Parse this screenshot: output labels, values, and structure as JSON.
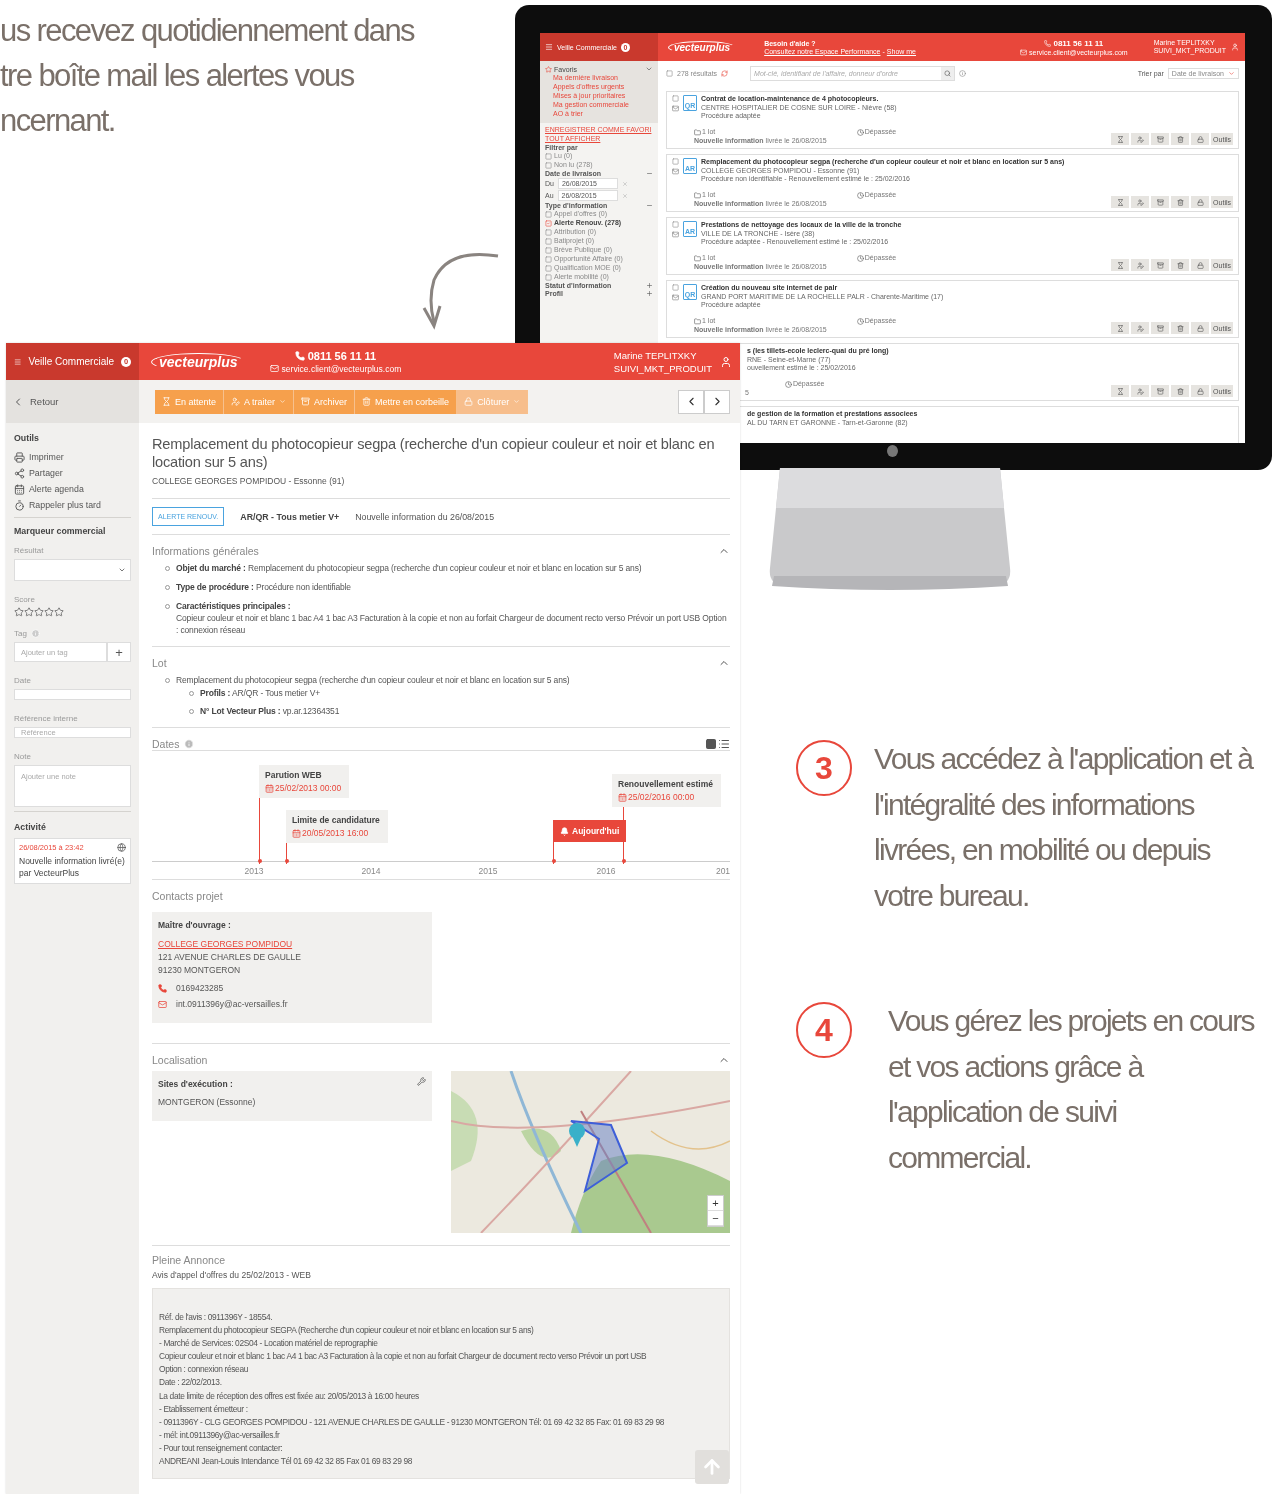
{
  "intro": {
    "lines": [
      "us recevez quotidiennement dans",
      "tre boîte mail les alertes vous",
      "ncernant."
    ]
  },
  "monitor_app": {
    "header": {
      "menu_label": "Veille Commerciale",
      "badge": "0",
      "logo": "vecteurplus",
      "help_title": "Besoin d'aide ?",
      "help_link": "Consultez notre Espace Performance",
      "help_sep": "-",
      "help_show": "Show me",
      "phone": "0811 56 11 11",
      "email": "service.client@vecteurplus.com",
      "user_name": "Marine TEPLITXKY",
      "user_role": "SUIVI_MKT_PRODUIT"
    },
    "sidebar": {
      "favorites_title": "Favoris",
      "expanded": true,
      "favorites": [
        "Ma dernière livraison",
        "Appels d'offres urgents",
        "Mises à jour prioritaires",
        "Ma gestion commerciale",
        "AO à trier"
      ],
      "save_link": "ENREGISTRER COMME FAVORI",
      "show_all_link": "TOUT AFFICHER",
      "filter_title": "Filtrer par",
      "filters": [
        {
          "label": "Lu",
          "count": "(0)",
          "checked": false
        },
        {
          "label": "Non lu",
          "count": "(278)",
          "checked": false
        }
      ],
      "date_title": "Date de livraison",
      "dates": [
        {
          "label": "Du",
          "value": "26/08/2015"
        },
        {
          "label": "Au",
          "value": "26/08/2015"
        }
      ],
      "type_title": "Type d'information",
      "types": [
        {
          "label": "Appel d'offres",
          "count": "(0)",
          "checked": false
        },
        {
          "label": "Alerte Renouv.",
          "count": "(278)",
          "checked": true
        },
        {
          "label": "Attribution",
          "count": "(0)",
          "checked": false
        },
        {
          "label": "Batiprojet",
          "count": "(0)",
          "checked": false
        },
        {
          "label": "Brève Publique",
          "count": "(0)",
          "checked": false
        },
        {
          "label": "Opportunité Affaire",
          "count": "(0)",
          "checked": false
        },
        {
          "label": "Qualification MOE",
          "count": "(0)",
          "checked": false
        },
        {
          "label": "Alerte mobilité",
          "count": "(0)",
          "checked": false
        }
      ],
      "collapsed_sections": [
        "Statut d'information",
        "Profil"
      ]
    },
    "toolbar": {
      "select_all_checked": false,
      "count": "278 résultats",
      "search_placeholder": "Mot-clé, identifiant de l'affaire, donneur d'ordre",
      "sort_label": "Trier par",
      "sort_value": "Date de livraison"
    },
    "results": [
      {
        "kind": "full",
        "checked": false,
        "badge": "QR",
        "title": "Contrat de location-maintenance de 4 photocopieurs.",
        "buyer": "CENTRE HOSPITALIER DE COSNE SUR LOIRE - Nièvre (58)",
        "procedure": "Procédure adaptée",
        "lots": "1 lot",
        "deadline": "Dépassée",
        "news_label": "Nouvelle information",
        "news_date": "livrée le 26/08/2015",
        "tools": "Outils"
      },
      {
        "kind": "full",
        "checked": false,
        "badge": "AR",
        "title": "Remplacement du photocopieur segpa (recherche d'un copieur couleur et noir et blanc en location sur 5 ans)",
        "buyer": "COLLEGE GEORGES POMPIDOU - Essonne (91)",
        "procedure": "Procédure non identifiable - Renouvellement estimé le : 25/02/2016",
        "lots": "1 lot",
        "deadline": "Dépassée",
        "news_label": "Nouvelle information",
        "news_date": "livrée le 26/08/2015",
        "tools": "Outils"
      },
      {
        "kind": "full",
        "checked": false,
        "badge": "AR",
        "title": "Prestations de nettoyage des locaux de la ville de la tronche",
        "buyer": "VILLE DE LA TRONCHE - Isère (38)",
        "procedure": "Procédure adaptée - Renouvellement estimé le : 25/02/2016",
        "lots": "1 lot",
        "deadline": "Dépassée",
        "news_label": "Nouvelle information",
        "news_date": "livrée le 26/08/2015",
        "tools": "Outils"
      },
      {
        "kind": "full",
        "checked": false,
        "badge": "QR",
        "title": "Création du nouveau site internet de palr",
        "buyer": "GRAND PORT MARITIME DE LA ROCHELLE PALR - Charente-Maritime (17)",
        "procedure": "Procédure adaptée",
        "lots": "1 lot",
        "deadline": "Dépassée",
        "news_label": "Nouvelle information",
        "news_date": "livrée le 26/08/2015",
        "tools": "Outils"
      },
      {
        "kind": "partial",
        "title": "s (les tillets-ecole leclerc-quai du pré long)",
        "buyer": "RNE - Seine-et-Marne (77)",
        "procedure": "ouvellement estimé le : 25/02/2016",
        "deadline": "Dépassée",
        "news_date": "5",
        "tools": "Outils"
      },
      {
        "kind": "partial",
        "title": "de gestion de la formation et prestations associees",
        "buyer": "AL DU TARN ET GARONNE - Tarn-et-Garonne (82)"
      }
    ]
  },
  "app": {
    "header": {
      "menu_label": "Veille Commerciale",
      "badge": "0",
      "logo": "vecteurplus",
      "phone": "0811 56 11 11",
      "email": "service.client@vecteurplus.com",
      "user_name": "Marine TEPLITXKY",
      "user_role": "SUIVI_MKT_PRODUIT"
    },
    "back": "Retour",
    "actions": [
      {
        "kind": "wait",
        "label": "En attente",
        "dropdown": false,
        "disabled": false
      },
      {
        "kind": "assign",
        "label": "A traiter",
        "dropdown": true,
        "disabled": false
      },
      {
        "kind": "archive",
        "label": "Archiver",
        "dropdown": false,
        "disabled": false
      },
      {
        "kind": "trash",
        "label": "Mettre en corbeille",
        "dropdown": false,
        "disabled": false
      },
      {
        "kind": "close",
        "label": "Clôturer",
        "dropdown": true,
        "disabled": true
      }
    ],
    "sidebar": {
      "tools_title": "Outils",
      "tools": [
        {
          "kind": "print",
          "label": "Imprimer"
        },
        {
          "kind": "share",
          "label": "Partager"
        },
        {
          "kind": "calendar",
          "label": "Alerte agenda"
        },
        {
          "kind": "timer",
          "label": "Rappeler plus tard"
        }
      ],
      "marker_title": "Marqueur commercial",
      "result_label": "Résultat",
      "score_label": "Score",
      "stars": 0,
      "tag_label": "Tag",
      "tag_placeholder": "Ajouter un tag",
      "tag_add": "+",
      "date_label": "Date",
      "ref_label": "Référence interne",
      "ref_placeholder": "Référence",
      "note_label": "Note",
      "note_placeholder": "Ajouter une note",
      "activity_title": "Activité",
      "activity": {
        "time": "26/08/2015 à 23:42",
        "text": "Nouvelle information livré(e) par VecteurPlus"
      }
    },
    "title": "Remplacement du photocopieur segpa (recherche d'un copieur couleur et noir et blanc en location sur 5 ans)",
    "subtitle": "COLLEGE GEORGES POMPIDOU - Essonne (91)",
    "tag": "ALERTE RENOUV.",
    "profile": "AR/QR - Tous metier V+",
    "news": "Nouvelle information du 26/08/2015",
    "general": {
      "title": "Informations générales",
      "expanded": true,
      "items": [
        {
          "kind": "inline",
          "label": "Objet du marché :",
          "value": "Remplacement du photocopieur segpa (recherche d'un copieur couleur et noir et blanc en location sur 5 ans)"
        },
        {
          "kind": "inline",
          "label": "Type de procédure :",
          "value": "Procédure non identifiable"
        },
        {
          "kind": "block",
          "label": "Caractéristiques principales :",
          "value": "Copieur couleur et noir et blanc 1 bac A4 1 bac A3 Facturation à la copie et non au forfait Chargeur de document recto verso Prévoir un port USB Option : connexion réseau"
        }
      ]
    },
    "lot": {
      "title": "Lot",
      "expanded": true,
      "text": "Remplacement du photocopieur segpa (recherche d'un copieur couleur et noir et blanc en location sur 5 ans)",
      "children": [
        {
          "label": "Profils :",
          "value": "AR/QR - Tous metier V+"
        },
        {
          "label": "N° Lot Vecteur Plus :",
          "value": "vp.ar.12364351"
        }
      ]
    },
    "dates": {
      "title": "Dates",
      "ticks": [
        "2013",
        "2014",
        "2015",
        "2016",
        "201"
      ],
      "events": [
        {
          "kind": "event",
          "label": "Parution WEB",
          "date": "25/02/2013 00:00"
        },
        {
          "kind": "event",
          "label": "Limite de candidature",
          "date": "20/05/2013 16:00"
        },
        {
          "kind": "today",
          "label": "Aujourd'hui"
        },
        {
          "kind": "event",
          "label": "Renouvellement estimé",
          "date": "25/02/2016 00:00"
        }
      ]
    },
    "contacts": {
      "title": "Contacts projet",
      "role": "Maître d'ouvrage :",
      "org": "COLLEGE GEORGES POMPIDOU",
      "address": [
        "121 AVENUE CHARLES DE GAULLE",
        "91230 MONTGERON"
      ],
      "phone": "0169423285",
      "email": "int.0911396y@ac-versailles.fr"
    },
    "location": {
      "title": "Localisation",
      "expanded": true,
      "sites_label": "Sites d'exécution :",
      "sites": "MONTGERON (Essonne)",
      "map": {
        "kind": "picture",
        "zoom_in": "+",
        "zoom_out": "−"
      }
    },
    "announcement": {
      "title": "Pleine Annonce",
      "subtitle": "Avis d'appel d'offres du 25/02/2013 - WEB",
      "lines": [
        "Réf. de l'avis : 0911396Y - 18554.",
        "Remplacement du photocopieur SEGPA (Recherche d'un copieur couleur et noir et blanc en location sur 5 ans)",
        "- Marché de Services: 02S04 - Location matériel de reprographie",
        "Copieur couleur et noir et blanc 1 bac A4 1 bac A3 Facturation à la copie et non au forfait Chargeur de document recto verso Prévoir un port USB",
        "Option : connexion réseau",
        "Date : 22/02/2013.",
        "La date limite de réception des offres est fixée au: 20/05/2013 à 16:00 heures",
        "- Etablissement émetteur :",
        "- 0911396Y - CLG GEORGES POMPIDOU - 121 AVENUE CHARLES DE GAULLE - 91230 MONTGERON Tél: 01 69 42 32 85 Fax: 01 69 83 29 98",
        "- mél: int.0911396y@ac-versailles.fr",
        "- Pour tout renseignement contacter:",
        "ANDREANI Jean-Louis Intendance Tél 01 69 42 32 85 Fax 01 69 83 29 98"
      ]
    }
  },
  "steps": [
    {
      "number": "3",
      "lines": [
        "Vous accédez  à l'application et à",
        "l'intégralité des informations",
        "livrées,  en mobilité ou depuis",
        "votre bureau."
      ]
    },
    {
      "number": "4",
      "lines": [
        "Vous gérez les projets en cours",
        "et vos actions grâce à",
        "l'application de suivi",
        "commercial."
      ]
    }
  ]
}
